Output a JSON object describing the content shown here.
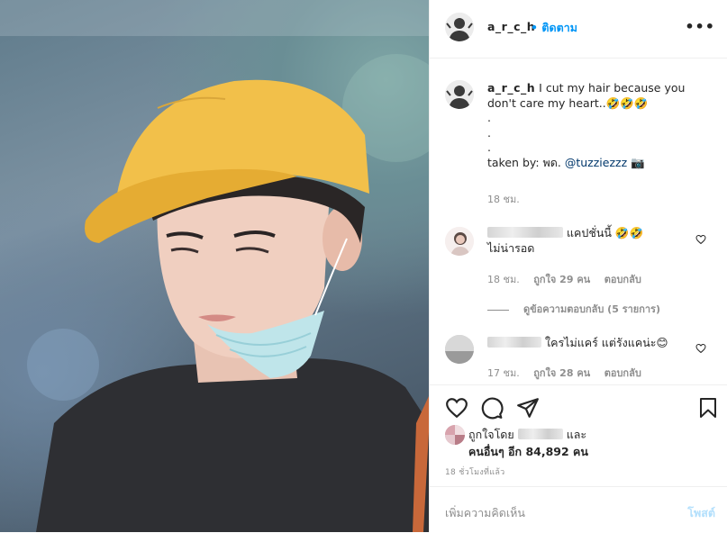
{
  "post": {
    "username": "a_r_c_h",
    "follow_label": "• ติดตาม",
    "more_icon": "more-dots-icon"
  },
  "caption": {
    "username": "a_r_c_h",
    "text_line1": "I cut my hair because you don't care my heart..",
    "emoji": "🤣🤣🤣",
    "dots": [
      ".",
      ".",
      "."
    ],
    "taken_by_prefix": "taken by: พด. ",
    "mention": "@tuzziezzz",
    "camera": "📷",
    "time": "18 ชม."
  },
  "comments": [
    {
      "text": "แคปชั่นนี้ 🤣🤣",
      "text2": "ไม่น่ารอด",
      "time": "18 ชม.",
      "likes": "ถูกใจ 29 คน",
      "reply": "ตอบกลับ",
      "view_replies": "ดูข้อความตอบกลับ (5 รายการ)"
    },
    {
      "text": "ใครไม่แคร์ แต่รังแคน่ะ😊",
      "time": "17 ชม.",
      "likes": "ถูกใจ 28 คน",
      "reply": "ตอบกลับ"
    }
  ],
  "likes_line": {
    "prefix": "ถูกใจโดย",
    "suffix": "และ",
    "others": "คนอื่นๆ อีก 84,892 คน"
  },
  "post_time": "18 ชั่วโมงที่แล้ว",
  "add_comment": {
    "placeholder": "เพิ่มความคิดเห็น",
    "post_label": "โพสต์"
  },
  "colors": {
    "accent": "#0095f6",
    "text": "#262626",
    "muted": "#8e8e8e",
    "post_disabled": "#b2dffc",
    "cap": "#f2c04a"
  }
}
